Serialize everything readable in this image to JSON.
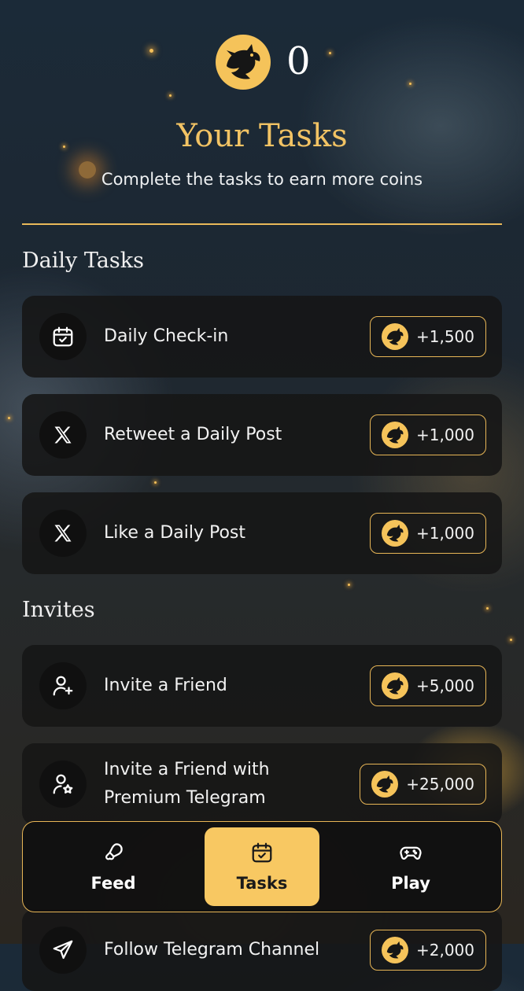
{
  "header": {
    "balance": "0",
    "coin_icon": "dragon-coin-icon",
    "title": "Your Tasks",
    "subtitle": "Complete the tasks to earn more coins"
  },
  "sections": {
    "daily_title": "Daily Tasks",
    "invites_title": "Invites"
  },
  "daily_tasks": [
    {
      "label": "Daily Check-in",
      "reward": "+1,500",
      "icon": "calendar-check-icon"
    },
    {
      "label": "Retweet a Daily Post",
      "reward": "+1,000",
      "icon": "x-logo-icon"
    },
    {
      "label": "Like a Daily Post",
      "reward": "+1,000",
      "icon": "x-logo-icon"
    }
  ],
  "invite_tasks": [
    {
      "label": "Invite a Friend",
      "reward": "+5,000",
      "icon": "user-plus-icon"
    },
    {
      "label_line1": "Invite a Friend with",
      "label_line2": "Premium Telegram",
      "reward": "+25,000",
      "icon": "user-star-icon"
    },
    {
      "label": "Follow Telegram Channel",
      "reward": "+2,000",
      "icon": "send-icon"
    }
  ],
  "nav": {
    "items": [
      {
        "label": "Feed",
        "icon": "feed-drumstick-icon"
      },
      {
        "label": "Tasks",
        "icon": "calendar-check-icon",
        "active": true
      },
      {
        "label": "Play",
        "icon": "gamepad-icon"
      }
    ]
  },
  "colors": {
    "accent": "#f5c35a",
    "title": "#f2c364",
    "card": "#161616"
  }
}
